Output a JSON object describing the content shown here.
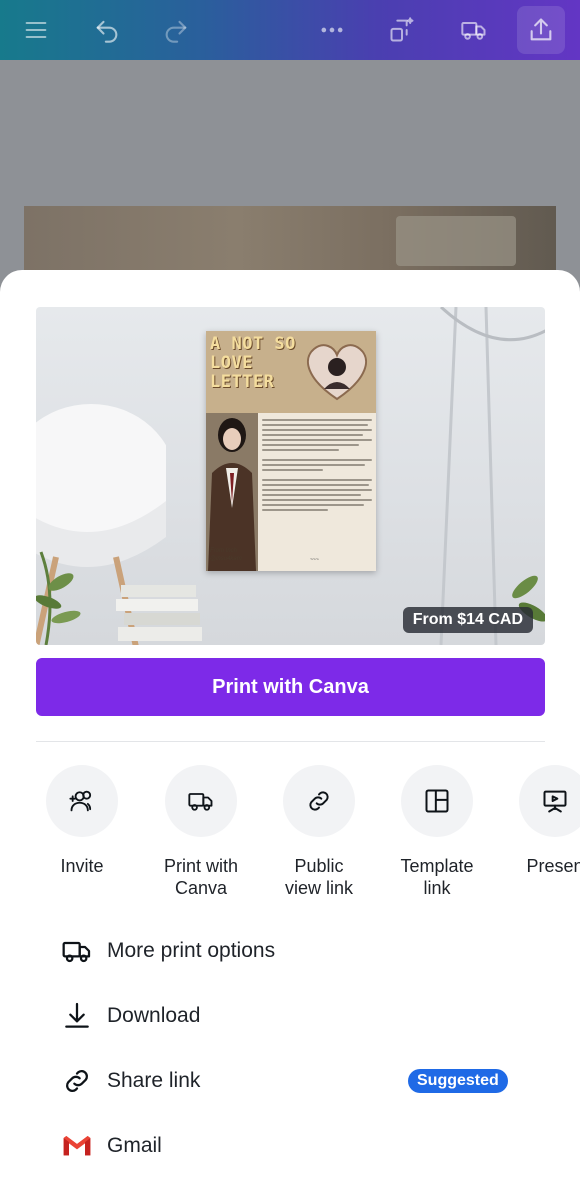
{
  "toolbar": {
    "icons": [
      "menu-icon",
      "undo-icon",
      "redo-icon",
      "more-icon",
      "magic-resize-icon",
      "print-truck-icon",
      "share-icon"
    ]
  },
  "preview": {
    "price": "From $14 CAD",
    "poster_title": "A NOT SO LOVE LETTER",
    "poster_from": "From Inch\n@insu4kam"
  },
  "print_button": {
    "label": "Print with Canva"
  },
  "share_options": [
    {
      "label": "Invite",
      "icon": "invite-people-icon"
    },
    {
      "label": "Print with\nCanva",
      "icon": "truck-icon"
    },
    {
      "label": "Public\nview link",
      "icon": "link-icon"
    },
    {
      "label": "Template\nlink",
      "icon": "template-icon"
    },
    {
      "label": "Presen",
      "icon": "present-icon"
    }
  ],
  "list": [
    {
      "label": "More print options",
      "icon": "truck-icon"
    },
    {
      "label": "Download",
      "icon": "download-icon"
    },
    {
      "label": "Share link",
      "icon": "link-icon",
      "badge": "Suggested"
    },
    {
      "label": "Gmail",
      "icon": "gmail-icon"
    }
  ],
  "colors": {
    "primary": "#7d2ae8",
    "badge": "#1f6ae6"
  }
}
